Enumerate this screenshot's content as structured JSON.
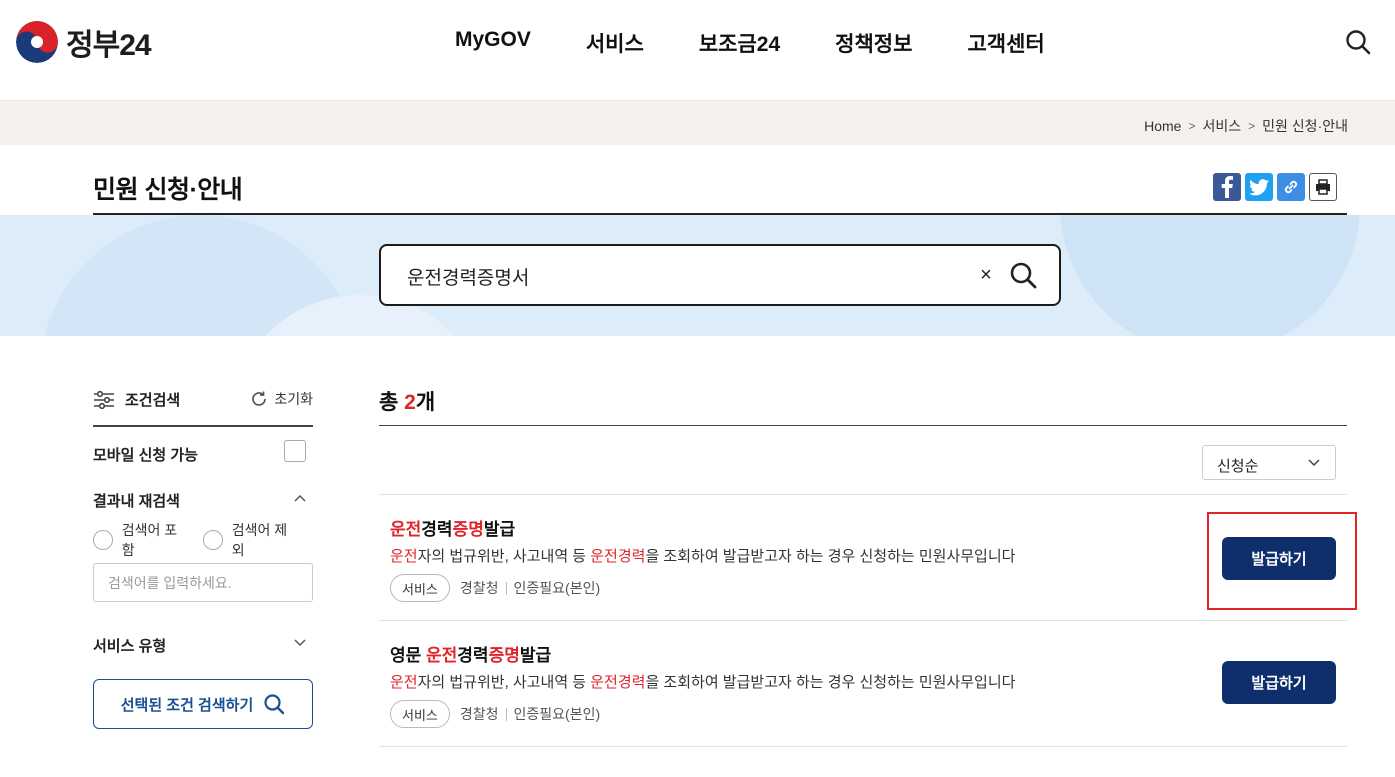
{
  "header": {
    "logo_text": "정부24",
    "nav": [
      "MyGOV",
      "서비스",
      "보조금24",
      "정책정보",
      "고객센터"
    ]
  },
  "breadcrumb": [
    "Home",
    "서비스",
    "민원 신청·안내"
  ],
  "page": {
    "title": "민원 신청·안내"
  },
  "search": {
    "query": "운전경력증명서",
    "clear_symbol": "×"
  },
  "sidebar": {
    "title": "조건검색",
    "reset_label": "초기화",
    "mobile_label": "모바일 신청 가능",
    "refine_label": "결과내 재검색",
    "include_label": "검색어 포함",
    "exclude_label": "검색어 제외",
    "refine_placeholder": "검색어를 입력하세요.",
    "service_type_label": "서비스 유형",
    "apply_button": "선택된 조건 검색하기"
  },
  "results": {
    "total_prefix": "총 ",
    "total_count": "2",
    "total_suffix": "개",
    "sort_label": "신청순",
    "items": [
      {
        "title_parts": [
          {
            "text": "운전",
            "hl": true
          },
          {
            "text": "경력",
            "hl": false
          },
          {
            "text": "증명",
            "hl": true
          },
          {
            "text": "발급",
            "hl": false
          }
        ],
        "desc_parts": [
          {
            "text": "운전",
            "hl": true
          },
          {
            "text": "자의 법규위반, 사고내역 등 ",
            "hl": false
          },
          {
            "text": "운전경력",
            "hl": true
          },
          {
            "text": "을 조회하여 발급받고자 하는 경우 신청하는 민원사무입니다",
            "hl": false
          }
        ],
        "tag": "서비스",
        "agency": "경찰청",
        "auth": "인증필요(본인)",
        "button": "발급하기"
      },
      {
        "title_parts": [
          {
            "text": "영문 ",
            "hl": false
          },
          {
            "text": "운전",
            "hl": true
          },
          {
            "text": "경력",
            "hl": false
          },
          {
            "text": "증명",
            "hl": true
          },
          {
            "text": "발급",
            "hl": false
          }
        ],
        "desc_parts": [
          {
            "text": "운전",
            "hl": true
          },
          {
            "text": "자의 법규위반, 사고내역 등 ",
            "hl": false
          },
          {
            "text": "운전경력",
            "hl": true
          },
          {
            "text": "을 조회하여 발급받고자 하는 경우 신청하는 민원사무입니다",
            "hl": false
          }
        ],
        "tag": "서비스",
        "agency": "경찰청",
        "auth": "인증필요(본인)",
        "button": "발급하기"
      }
    ]
  },
  "colors": {
    "accent_navy": "#0e2e6c",
    "highlight_red": "#e0242a",
    "band_blue": "#dcecf9"
  }
}
